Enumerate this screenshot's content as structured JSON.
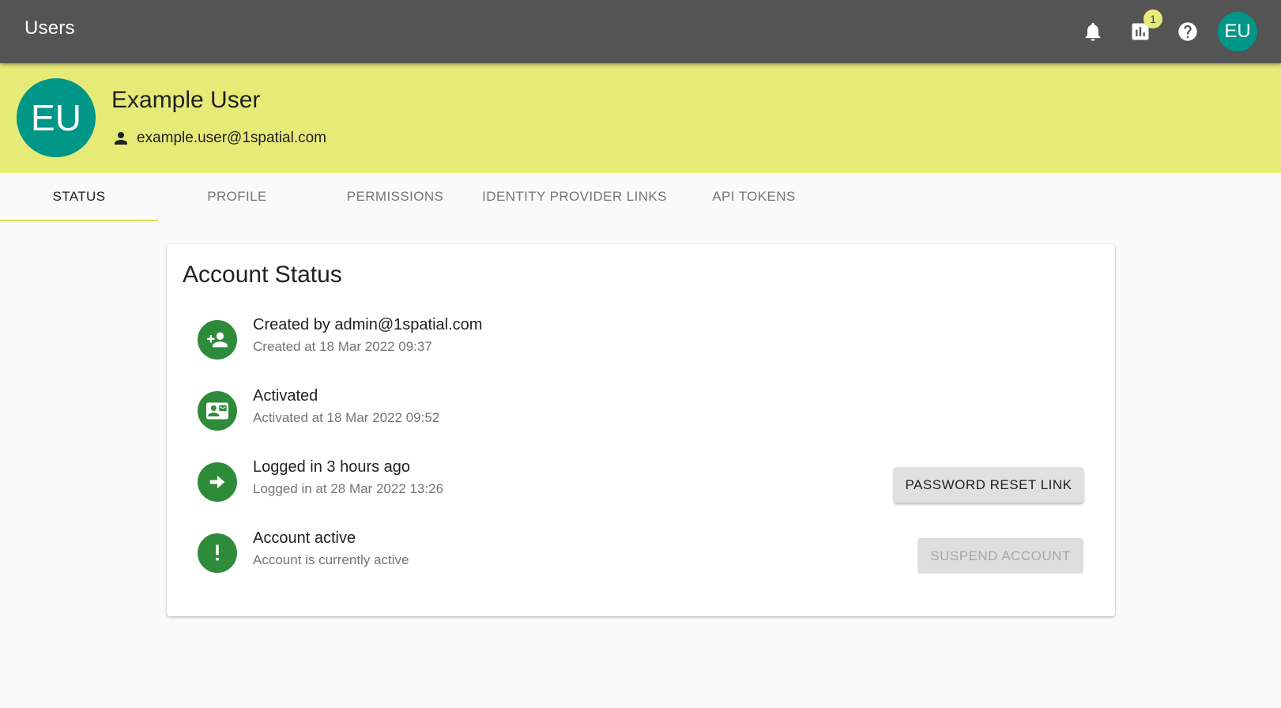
{
  "appbar": {
    "title": "Users",
    "icons": [
      "bell-icon",
      "bar-chart-icon",
      "help-icon"
    ],
    "chart_badge": "1",
    "avatar_initials": "EU"
  },
  "profile": {
    "initials": "EU",
    "name": "Example User",
    "email": "example.user@1spatial.com"
  },
  "tabs": [
    {
      "label": "STATUS",
      "active": true
    },
    {
      "label": "PROFILE",
      "active": false
    },
    {
      "label": "PERMISSIONS",
      "active": false
    },
    {
      "label": "IDENTITY PROVIDER LINKS",
      "active": false
    },
    {
      "label": "API TOKENS",
      "active": false
    }
  ],
  "account_status": {
    "title": "Account Status",
    "items": [
      {
        "icon": "add-user-icon",
        "primary": "Created by admin@1spatial.com",
        "secondary": "Created at 18 Mar 2022 09:37"
      },
      {
        "icon": "contact-mail-icon",
        "primary": "Activated",
        "secondary": "Activated at 18 Mar 2022 09:52"
      },
      {
        "icon": "arrow-right-circle-icon",
        "primary": "Logged in 3 hours ago",
        "secondary": "Logged in at 28 Mar 2022 13:26"
      },
      {
        "icon": "exclamation-icon",
        "primary": "Account active",
        "secondary": "Account is currently active"
      }
    ],
    "password_reset_label": "PASSWORD RESET LINK",
    "suspend_label": "SUSPEND ACCOUNT",
    "suspend_disabled": true
  },
  "colors": {
    "appbar": "#545454",
    "header": "#e6eb78",
    "avatar": "#009688",
    "status_icon": "#2e8b3a",
    "tab_indicator": "#dde14f"
  }
}
